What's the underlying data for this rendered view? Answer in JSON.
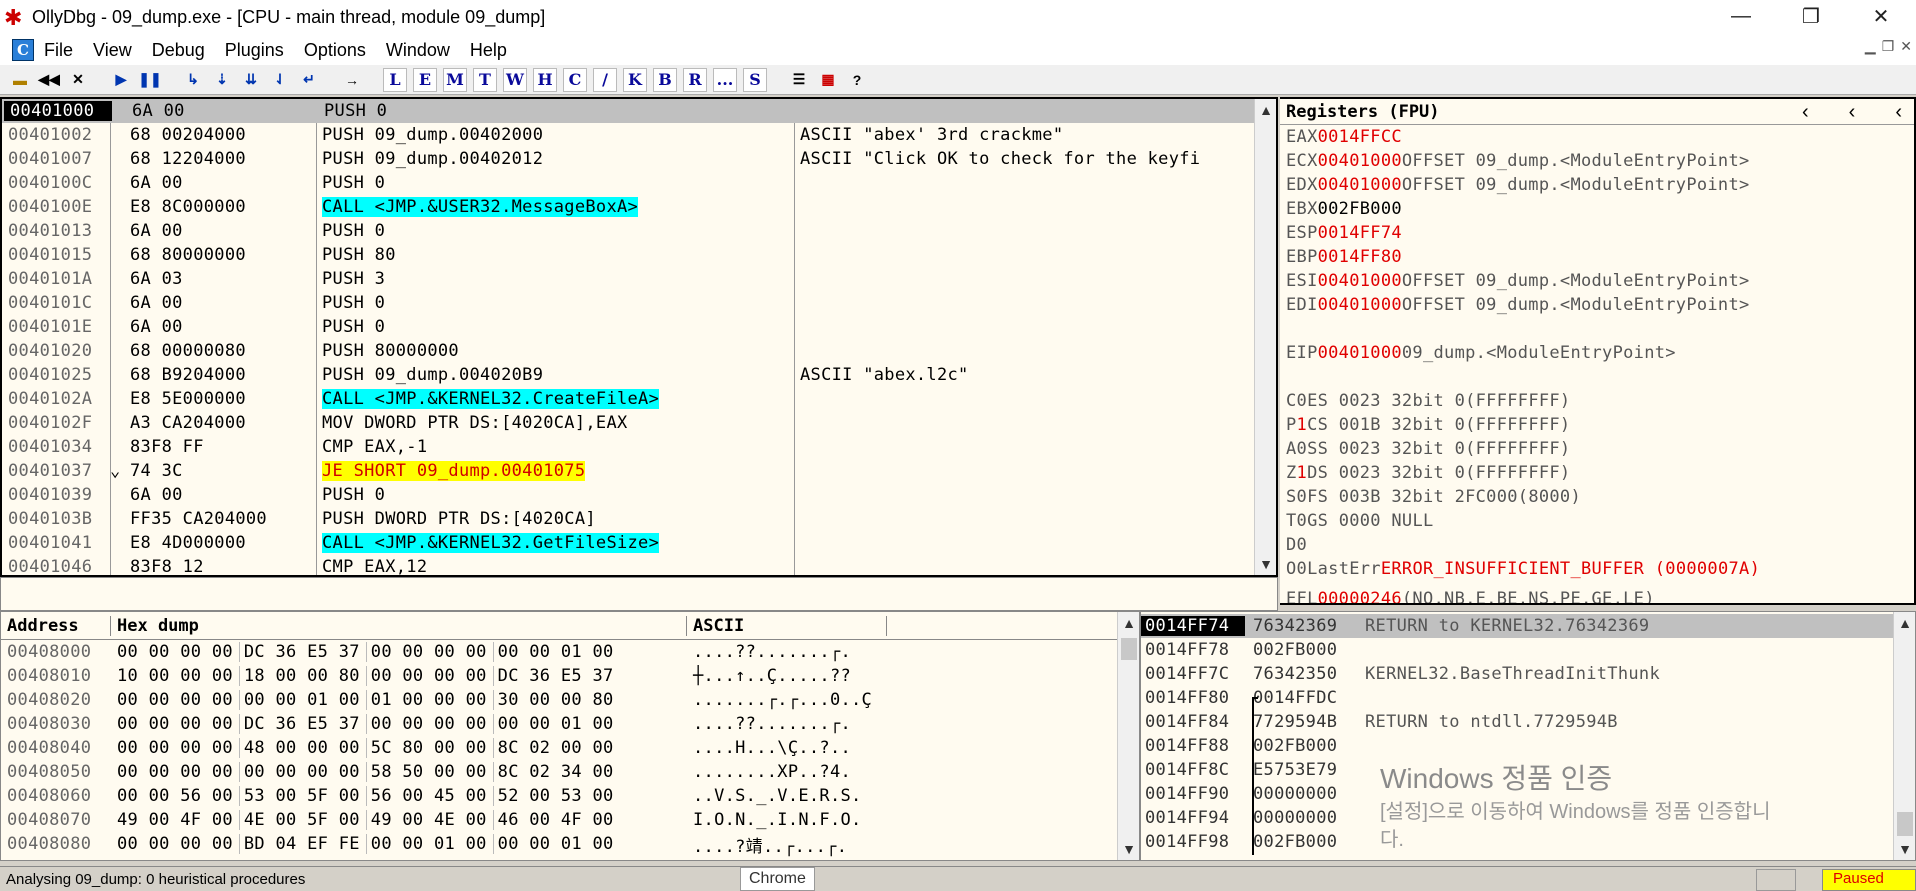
{
  "window": {
    "title": "OllyDbg - 09_dump.exe - [CPU - main thread, module 09_dump]",
    "app_icon": "bug-icon"
  },
  "menu": {
    "items": [
      "File",
      "Debug",
      "Plugins",
      "Options",
      "Window",
      "Help"
    ],
    "view": "View"
  },
  "toolbar": {
    "letters": [
      "L",
      "E",
      "M",
      "T",
      "W",
      "H",
      "C",
      "/",
      "K",
      "B",
      "R",
      "...",
      "S"
    ]
  },
  "cpu": {
    "rows": [
      {
        "addr": "00401000",
        "hex": "6A 00",
        "dis": "PUSH 0",
        "com": "",
        "style": "sel"
      },
      {
        "addr": "00401002",
        "hex": "68 00204000",
        "dis": "PUSH 09_dump.00402000",
        "com": "ASCII \"abex' 3rd crackme\"",
        "style": ""
      },
      {
        "addr": "00401007",
        "hex": "68 12204000",
        "dis": "PUSH 09_dump.00402012",
        "com": "ASCII \"Click OK to check for the keyfi",
        "style": ""
      },
      {
        "addr": "0040100C",
        "hex": "6A 00",
        "dis": "PUSH 0",
        "com": "",
        "style": ""
      },
      {
        "addr": "0040100E",
        "hex": "E8 8C000000",
        "dis": "CALL <JMP.&USER32.MessageBoxA>",
        "com": "",
        "style": "cyan"
      },
      {
        "addr": "00401013",
        "hex": "6A 00",
        "dis": "PUSH 0",
        "com": "",
        "style": ""
      },
      {
        "addr": "00401015",
        "hex": "68 80000000",
        "dis": "PUSH 80",
        "com": "",
        "style": ""
      },
      {
        "addr": "0040101A",
        "hex": "6A 03",
        "dis": "PUSH 3",
        "com": "",
        "style": ""
      },
      {
        "addr": "0040101C",
        "hex": "6A 00",
        "dis": "PUSH 0",
        "com": "",
        "style": ""
      },
      {
        "addr": "0040101E",
        "hex": "6A 00",
        "dis": "PUSH 0",
        "com": "",
        "style": ""
      },
      {
        "addr": "00401020",
        "hex": "68 00000080",
        "dis": "PUSH 80000000",
        "com": "",
        "style": ""
      },
      {
        "addr": "00401025",
        "hex": "68 B9204000",
        "dis": "PUSH 09_dump.004020B9",
        "com": "ASCII \"abex.l2c\"",
        "style": ""
      },
      {
        "addr": "0040102A",
        "hex": "E8 5E000000",
        "dis": "CALL <JMP.&KERNEL32.CreateFileA>",
        "com": "",
        "style": "cyan"
      },
      {
        "addr": "0040102F",
        "hex": "A3 CA204000",
        "dis": "MOV DWORD PTR DS:[4020CA],EAX",
        "com": "",
        "style": ""
      },
      {
        "addr": "00401034",
        "hex": "83F8 FF",
        "dis": "CMP EAX,-1",
        "com": "",
        "style": ""
      },
      {
        "addr": "00401037",
        "hex": "74 3C",
        "dis": "JE SHORT 09_dump.00401075",
        "com": "",
        "style": "yellow",
        "arrow": "⌄"
      },
      {
        "addr": "00401039",
        "hex": "6A 00",
        "dis": "PUSH 0",
        "com": "",
        "style": ""
      },
      {
        "addr": "0040103B",
        "hex": "FF35 CA204000",
        "dis": "PUSH DWORD PTR DS:[4020CA]",
        "com": "",
        "style": ""
      },
      {
        "addr": "00401041",
        "hex": "E8 4D000000",
        "dis": "CALL <JMP.&KERNEL32.GetFileSize>",
        "com": "",
        "style": "cyan"
      },
      {
        "addr": "00401046",
        "hex": "83F8 12",
        "dis": "CMP EAX,12",
        "com": "",
        "style": ""
      }
    ]
  },
  "registers": {
    "header": "Registers (FPU)",
    "gp": [
      {
        "name": "EAX",
        "val": "0014FFCC",
        "desc": ""
      },
      {
        "name": "ECX",
        "val": "00401000",
        "desc": "OFFSET 09_dump.<ModuleEntryPoint>"
      },
      {
        "name": "EDX",
        "val": "00401000",
        "desc": "OFFSET 09_dump.<ModuleEntryPoint>"
      },
      {
        "name": "EBX",
        "val": "002FB000",
        "desc": "",
        "plain": true
      },
      {
        "name": "ESP",
        "val": "0014FF74",
        "desc": ""
      },
      {
        "name": "EBP",
        "val": "0014FF80",
        "desc": ""
      },
      {
        "name": "ESI",
        "val": "00401000",
        "desc": "OFFSET 09_dump.<ModuleEntryPoint>"
      },
      {
        "name": "EDI",
        "val": "00401000",
        "desc": "OFFSET 09_dump.<ModuleEntryPoint>"
      }
    ],
    "eip": {
      "name": "EIP",
      "val": "00401000",
      "desc": "09_dump.<ModuleEntryPoint>"
    },
    "flags": [
      {
        "f": "C",
        "v": "0",
        "seg": "ES 0023 32bit 0(FFFFFFFF)"
      },
      {
        "f": "P",
        "v": "1",
        "seg": "CS 001B 32bit 0(FFFFFFFF)"
      },
      {
        "f": "A",
        "v": "0",
        "seg": "SS 0023 32bit 0(FFFFFFFF)"
      },
      {
        "f": "Z",
        "v": "1",
        "seg": "DS 0023 32bit 0(FFFFFFFF)"
      },
      {
        "f": "S",
        "v": "0",
        "seg": "FS 003B 32bit 2FC000(8000)"
      },
      {
        "f": "T",
        "v": "0",
        "seg": "GS 0000 NULL"
      },
      {
        "f": "D",
        "v": "0",
        "seg": ""
      },
      {
        "f": "O",
        "v": "0",
        "seg": "LastErr"
      }
    ],
    "lasterr": "ERROR_INSUFFICIENT_BUFFER (0000007A)",
    "efl": {
      "name": "EFL",
      "val": "00000246",
      "desc": "(NO,NB,E,BE,NS,PE,GE,LE)"
    }
  },
  "dump": {
    "headers": [
      "Address",
      "Hex dump",
      "ASCII"
    ],
    "rows": [
      {
        "addr": "00408000",
        "hex": "00 00 00 00|DC 36 E5 37|00 00 00 00|00 00 01 00",
        "asc": "....??.......┌."
      },
      {
        "addr": "00408010",
        "hex": "10 00 00 00|18 00 00 80|00 00 00 00|DC 36 E5 37",
        "asc": "┼...↑..Ç.....??"
      },
      {
        "addr": "00408020",
        "hex": "00 00 00 00|00 00 01 00|01 00 00 00|30 00 00 80",
        "asc": ".......┌.┌...0..Ç"
      },
      {
        "addr": "00408030",
        "hex": "00 00 00 00|DC 36 E5 37|00 00 00 00|00 00 01 00",
        "asc": "....??.......┌."
      },
      {
        "addr": "00408040",
        "hex": "00 00 00 00|48 00 00 00|5C 80 00 00|8C 02 00 00",
        "asc": "....H...\\Ç..?.."
      },
      {
        "addr": "00408050",
        "hex": "00 00 00 00|00 00 00 00|58 50 00 00|8C 02 34 00",
        "asc": "........XP..?4."
      },
      {
        "addr": "00408060",
        "hex": "00 00 56 00|53 00 5F 00|56 00 45 00|52 00 53 00",
        "asc": "..V.S._.V.E.R.S."
      },
      {
        "addr": "00408070",
        "hex": "49 00 4F 00|4E 00 5F 00|49 00 4E 00|46 00 4F 00",
        "asc": "I.O.N._.I.N.F.O."
      },
      {
        "addr": "00408080",
        "hex": "00 00 00 00|BD 04 EF FE|00 00 01 00|00 00 01 00",
        "asc": "....?靖..┌...┌."
      }
    ]
  },
  "stack": {
    "rows": [
      {
        "addr": "0014FF74",
        "val": "76342369",
        "com": "RETURN to KERNEL32.76342369",
        "sel": true
      },
      {
        "addr": "0014FF78",
        "val": "002FB000",
        "com": ""
      },
      {
        "addr": "0014FF7C",
        "val": "76342350",
        "com": "KERNEL32.BaseThreadInitThunk"
      },
      {
        "addr": "0014FF80",
        "val": "0014FFDC",
        "com": ""
      },
      {
        "addr": "0014FF84",
        "val": "7729594B",
        "com": "RETURN to ntdll.7729594B"
      },
      {
        "addr": "0014FF88",
        "val": "002FB000",
        "com": ""
      },
      {
        "addr": "0014FF8C",
        "val": "E5753E79",
        "com": ""
      },
      {
        "addr": "0014FF90",
        "val": "00000000",
        "com": ""
      },
      {
        "addr": "0014FF94",
        "val": "00000000",
        "com": ""
      },
      {
        "addr": "0014FF98",
        "val": "002FB000",
        "com": ""
      }
    ]
  },
  "watermark": {
    "title": "Windows 정품 인증",
    "line1": "[설정]으로 이동하여 Windows를 정품 인증합니",
    "line2": "다."
  },
  "status": {
    "message": "Analysing 09_dump: 0 heuristical procedures",
    "chrome": "Chrome",
    "state": "Paused"
  },
  "colors": {
    "cyan": "#00FFFF",
    "yellow": "#FFFF00",
    "red": "#E00000",
    "paused_bg": "#FFFF00"
  }
}
